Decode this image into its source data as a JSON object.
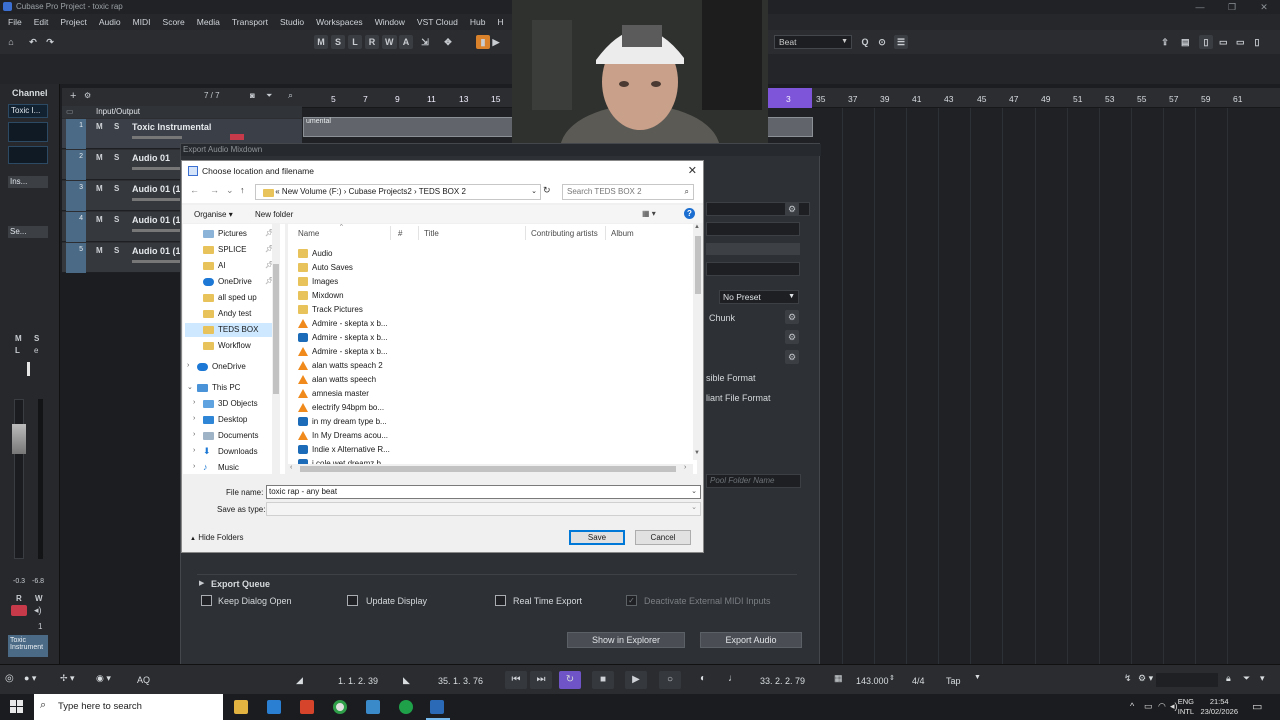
{
  "window": {
    "title": "Cubase Pro Project - toxic rap",
    "controls": [
      "—",
      "❐",
      "✕"
    ]
  },
  "menu": [
    "File",
    "Edit",
    "Project",
    "Audio",
    "MIDI",
    "Score",
    "Media",
    "Transport",
    "Studio",
    "Workspaces",
    "Window",
    "VST Cloud",
    "Hub",
    "H"
  ],
  "toolbar": {
    "buttons": [
      "M",
      "S",
      "L",
      "R",
      "W",
      "A"
    ],
    "snap_select": "Beat"
  },
  "channel_panel": {
    "header": "Channel",
    "track_name": "Toxic I...",
    "inserts": "Ins...",
    "sends": "Se...",
    "meter_left": "-0.3",
    "meter_right": "-6.8",
    "rw": [
      "R",
      "W"
    ],
    "number": "1",
    "name_box": "Toxic Instrument"
  },
  "tracklist": {
    "count": "7 / 7",
    "folder": "Input/Output",
    "tracks": [
      {
        "num": "1",
        "name": "Toxic Instrumental"
      },
      {
        "num": "2",
        "name": "Audio 01"
      },
      {
        "num": "3",
        "name": "Audio 01 (1"
      },
      {
        "num": "4",
        "name": "Audio 01 (1"
      },
      {
        "num": "5",
        "name": "Audio 01 (1"
      }
    ],
    "ms": [
      "M",
      "S"
    ]
  },
  "ruler": {
    "ticks_loop": [
      "5",
      "7",
      "9",
      "11",
      "13",
      "15"
    ],
    "ticks_after": [
      "3",
      "35",
      "37",
      "39",
      "41",
      "43",
      "45",
      "47",
      "49",
      "51",
      "53",
      "55",
      "57",
      "59",
      "61"
    ]
  },
  "event": {
    "label": "umental"
  },
  "export_window": {
    "title": "Export Audio Mixdown",
    "preset": "No Preset",
    "chunk_label": "Chunk",
    "format1": "sible Format",
    "format2": "liant File Format",
    "pool_folder": "Pool Folder Name",
    "queue_label": "Export Queue",
    "checkboxes": [
      {
        "label": "Keep Dialog Open",
        "checked": false
      },
      {
        "label": "Update Display",
        "checked": false
      },
      {
        "label": "Real Time Export",
        "checked": false
      },
      {
        "label": "Deactivate External MIDI Inputs",
        "checked": true
      }
    ],
    "show_in_explorer": "Show in Explorer",
    "export_audio": "Export Audio"
  },
  "file_dialog": {
    "title": "Choose location and filename",
    "address": [
      "«",
      "New Volume (F:)",
      "›",
      "Cubase Projects2",
      "›",
      "TEDS BOX 2"
    ],
    "search_placeholder": "Search TEDS BOX 2",
    "organise": "Organise",
    "new_folder": "New folder",
    "nav": {
      "quick_access": [
        {
          "name": "Pictures",
          "pinned": true
        },
        {
          "name": "SPLICE",
          "pinned": true
        },
        {
          "name": "AI",
          "pinned": true
        },
        {
          "name": "OneDrive",
          "pinned": true
        },
        {
          "name": "all sped up",
          "pinned": false
        },
        {
          "name": "Andy test",
          "pinned": false
        },
        {
          "name": "TEDS BOX",
          "pinned": false
        },
        {
          "name": "Workflow",
          "pinned": false
        }
      ],
      "onedrive": "OneDrive",
      "this_pc": "This PC",
      "pc_items": [
        "3D Objects",
        "Desktop",
        "Documents",
        "Downloads",
        "Music"
      ]
    },
    "columns": [
      "Name",
      "#",
      "Title",
      "Contributing artists",
      "Album"
    ],
    "files": [
      {
        "name": "Audio",
        "type": "folder"
      },
      {
        "name": "Auto Saves",
        "type": "folder"
      },
      {
        "name": "Images",
        "type": "folder"
      },
      {
        "name": "Mixdown",
        "type": "folder"
      },
      {
        "name": "Track Pictures",
        "type": "folder"
      },
      {
        "name": "Admire - skepta x b...",
        "type": "vlc"
      },
      {
        "name": "Admire - skepta x b...",
        "type": "app"
      },
      {
        "name": "Admire - skepta x b...",
        "type": "vlc"
      },
      {
        "name": "alan watts speach 2",
        "type": "vlc"
      },
      {
        "name": "alan watts speech",
        "type": "vlc"
      },
      {
        "name": "amnesia master",
        "type": "vlc"
      },
      {
        "name": "electrify 94bpm bo...",
        "type": "vlc"
      },
      {
        "name": "in my dream type b...",
        "type": "app"
      },
      {
        "name": "In My Dreams acou...",
        "type": "vlc"
      },
      {
        "name": "Indie x Alternative R...",
        "type": "app"
      },
      {
        "name": "i cole wet dreamz b...",
        "type": "app"
      }
    ],
    "file_name_label": "File name:",
    "file_name_value": "toxic rap - any beat",
    "save_as_label": "Save as type:",
    "save_as_value": "",
    "hide_folders": "Hide Folders",
    "save": "Save",
    "cancel": "Cancel"
  },
  "transport": {
    "left_locator": "1. 1. 2. 39",
    "right_locator": "35. 1. 3. 76",
    "position": "33. 2. 2. 79",
    "tempo": "143.000",
    "signature": "4/4",
    "tap": "Tap",
    "aq": "AQ"
  },
  "taskbar": {
    "search_placeholder": "Type here to search",
    "lang_top": "ENG",
    "lang_bottom": "INTL",
    "time": "21:54",
    "date": "23/02/2026"
  },
  "colors": {
    "loop_region": "#7e55d9",
    "accent_blue": "#0078d7",
    "folder": "#e8c25a"
  }
}
